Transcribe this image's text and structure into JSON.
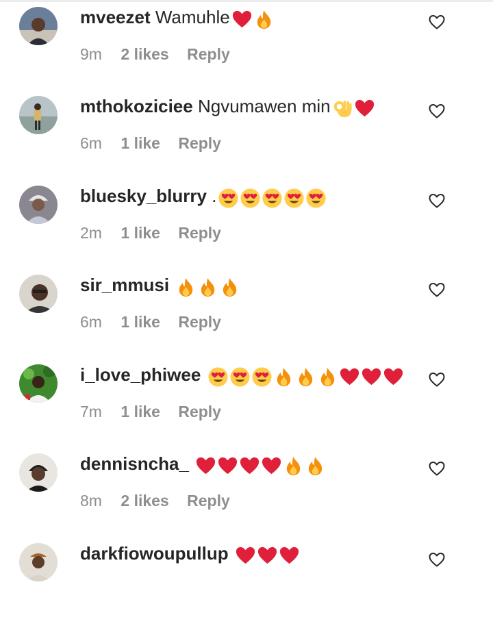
{
  "comments": [
    {
      "username": "mveezet",
      "text": "Wamuhle",
      "emojis": [
        "heart-emoji",
        "fire-emoji"
      ],
      "time": "9m",
      "likes": "2 likes",
      "reply": "Reply",
      "avatar_icon": "user-avatar-1"
    },
    {
      "username": "mthokoziciee",
      "text": "Ngvumawen min",
      "emojis": [
        "ok-hand-emoji",
        "heart-emoji"
      ],
      "time": "6m",
      "likes": "1 like",
      "reply": "Reply",
      "avatar_icon": "user-avatar-2"
    },
    {
      "username": "bluesky_blurry",
      "text": ".",
      "emojis": [
        "heart-eyes-emoji",
        "heart-eyes-emoji",
        "heart-eyes-emoji",
        "heart-eyes-emoji",
        "heart-eyes-emoji"
      ],
      "time": "2m",
      "likes": "1 like",
      "reply": "Reply",
      "avatar_icon": "user-avatar-3"
    },
    {
      "username": "sir_mmusi",
      "text": "",
      "emojis": [
        "fire-emoji",
        "fire-emoji",
        "fire-emoji"
      ],
      "time": "6m",
      "likes": "1 like",
      "reply": "Reply",
      "avatar_icon": "user-avatar-4"
    },
    {
      "username": "i_love_phiwee",
      "text": "",
      "emojis": [
        "heart-eyes-emoji",
        "heart-eyes-emoji",
        "heart-eyes-emoji",
        "fire-emoji",
        "fire-emoji",
        "fire-emoji",
        "heart-emoji",
        "heart-emoji",
        "heart-emoji"
      ],
      "time": "7m",
      "likes": "1 like",
      "reply": "Reply",
      "avatar_icon": "user-avatar-5"
    },
    {
      "username": "dennisncha_",
      "text": "",
      "emojis": [
        "heart-emoji",
        "heart-emoji",
        "heart-emoji",
        "heart-emoji",
        "fire-emoji",
        "fire-emoji"
      ],
      "time": "8m",
      "likes": "2 likes",
      "reply": "Reply",
      "avatar_icon": "user-avatar-6"
    },
    {
      "username": "darkfiowoupullup",
      "text": "",
      "emojis": [
        "heart-emoji",
        "heart-emoji",
        "heart-emoji"
      ],
      "time": "",
      "likes": "",
      "reply": "",
      "avatar_icon": "user-avatar-7"
    }
  ],
  "colors": {
    "meta_gray": "#8e8e8e",
    "heart_red": "#e0203a",
    "fire_orange": "#f4900c",
    "heart_eyes_yellow": "#ffcc4d"
  },
  "icons": {
    "like_button": "heart-outline-icon"
  }
}
